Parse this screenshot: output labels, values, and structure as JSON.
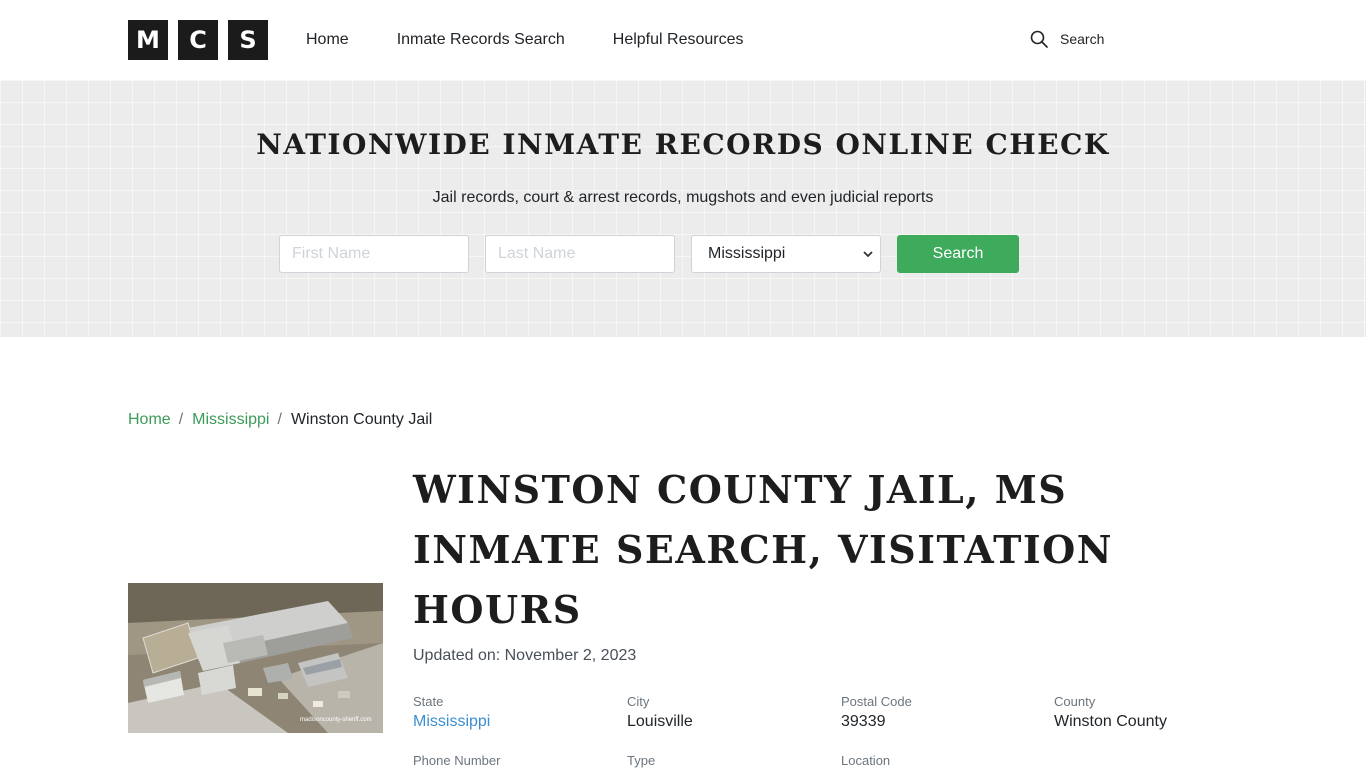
{
  "header": {
    "logo_letters": [
      "M",
      "C",
      "S"
    ],
    "nav": [
      "Home",
      "Inmate Records Search",
      "Helpful Resources"
    ],
    "search_label": "Search"
  },
  "hero": {
    "title": "NATIONWIDE INMATE RECORDS ONLINE CHECK",
    "subtitle": "Jail records, court & arrest records, mugshots and even judicial reports",
    "first_name_placeholder": "First Name",
    "last_name_placeholder": "Last Name",
    "state_selected": "Mississippi",
    "search_button": "Search",
    "button_color": "#3daa5c"
  },
  "breadcrumb": {
    "items": [
      "Home",
      "Mississippi",
      "Winston County Jail"
    ],
    "separator": "/"
  },
  "main": {
    "image_watermark": "madisoncounty-sheriff.com",
    "title": "WINSTON COUNTY JAIL, MS INMATE SEARCH, VISITATION HOURS",
    "updated": "Updated on: November 2, 2023",
    "facts": [
      {
        "label": "State",
        "value": "Mississippi"
      },
      {
        "label": "City",
        "value": "Louisville"
      },
      {
        "label": "Postal Code",
        "value": "39339"
      },
      {
        "label": "County",
        "value": "Winston County"
      },
      {
        "label": "Phone Number",
        "value": ""
      },
      {
        "label": "Type",
        "value": ""
      },
      {
        "label": "Location",
        "value": ""
      }
    ],
    "link_color": "#3b8ecf"
  }
}
